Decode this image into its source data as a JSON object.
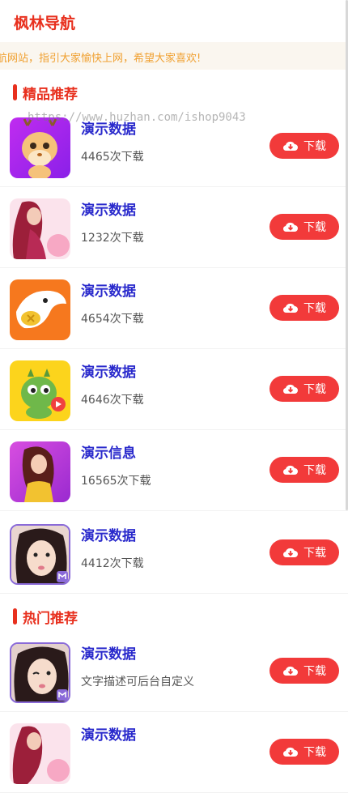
{
  "header": {
    "title": "枫林导航"
  },
  "marquee": {
    "text": "航网站，指引大家愉快上网，希望大家喜欢!"
  },
  "sections": [
    {
      "title": "精品推荐"
    },
    {
      "title": "热门推荐"
    }
  ],
  "download_label": "下载",
  "watermark": "https://www.huzhan.com/ishop9043",
  "featured": [
    {
      "name": "演示数据",
      "desc": "4465次下载",
      "icon": "deer-cartoon-icon"
    },
    {
      "name": "演示数据",
      "desc": "1232次下载",
      "icon": "woman-pink-icon"
    },
    {
      "name": "演示数据",
      "desc": "4654次下载",
      "icon": "shark-orange-icon"
    },
    {
      "name": "演示数据",
      "desc": "4646次下载",
      "icon": "dragon-yellow-icon"
    },
    {
      "name": "演示信息",
      "desc": "16565次下载",
      "icon": "woman-purple-icon"
    },
    {
      "name": "演示数据",
      "desc": "4412次下载",
      "icon": "girl-portrait-icon"
    }
  ],
  "hot": [
    {
      "name": "演示数据",
      "desc": "文字描述可后台自定义",
      "icon": "girl-portrait-icon"
    },
    {
      "name": "演示数据",
      "desc": "",
      "icon": "woman-pink-icon"
    }
  ],
  "colors": {
    "accent": "#e8301e",
    "button": "#f23a3a",
    "name": "#2a2acc",
    "marquee": "#f0a030"
  }
}
